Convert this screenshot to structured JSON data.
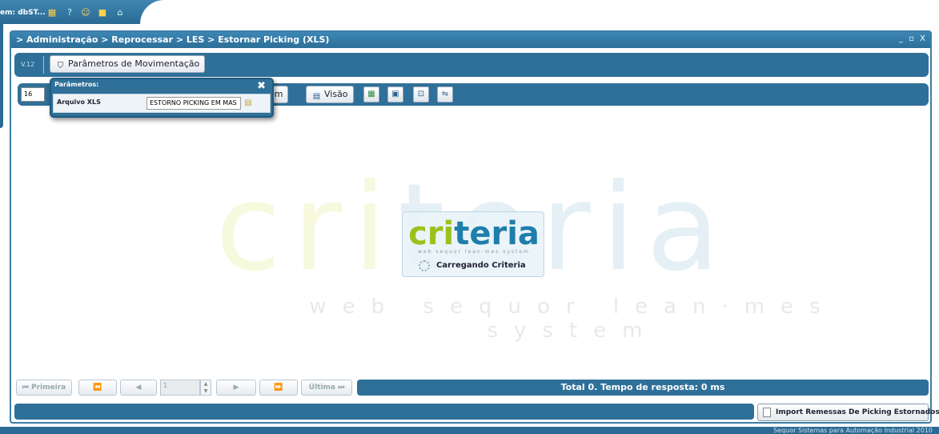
{
  "topbar": {
    "system_label": "em: dbST...",
    "icons": [
      "grid-icon",
      "help-icon",
      "user-icon",
      "lock-icon",
      "home-icon"
    ]
  },
  "window": {
    "breadcrumb": "> Administração > Reprocessar > LES > Estornar Picking (XLS)",
    "controls": "_ ▫ X"
  },
  "toolbar": {
    "version": "V.12",
    "params_button": "Parâmetros de Movimentação"
  },
  "grid_toolbar": {
    "page_size": "16",
    "order_button_partial": "dem",
    "view_button": "Visão",
    "icons": [
      "excel-icon",
      "save-icon",
      "export-icon",
      "filter-icon"
    ]
  },
  "params_popup": {
    "title": "Parâmetros:",
    "close": "✖",
    "field_label": "Arquivo XLS",
    "field_value": "ESTORNO PICKING EM MAS"
  },
  "watermark": {
    "word_part1": "cri",
    "word_part2": "teria",
    "subtitle": "web sequor lean·mes system"
  },
  "loader": {
    "logo_part1": "cri",
    "logo_part2": "teria",
    "tagline": "web sequor lean·mes system",
    "message": "Carregando Criteria"
  },
  "pager": {
    "first": "⏮ Primeira",
    "prev_fast": "⏪",
    "prev": "◀",
    "page_value": "1",
    "next": "▶",
    "next_fast": "⏩",
    "last": "Última ⏭"
  },
  "status": {
    "text": "Total 0. Tempo de resposta: 0 ms"
  },
  "import_button": "Import Remessas De Picking Estornados",
  "footer": "Sequor Sistemas para Automação Industrial 2010"
}
